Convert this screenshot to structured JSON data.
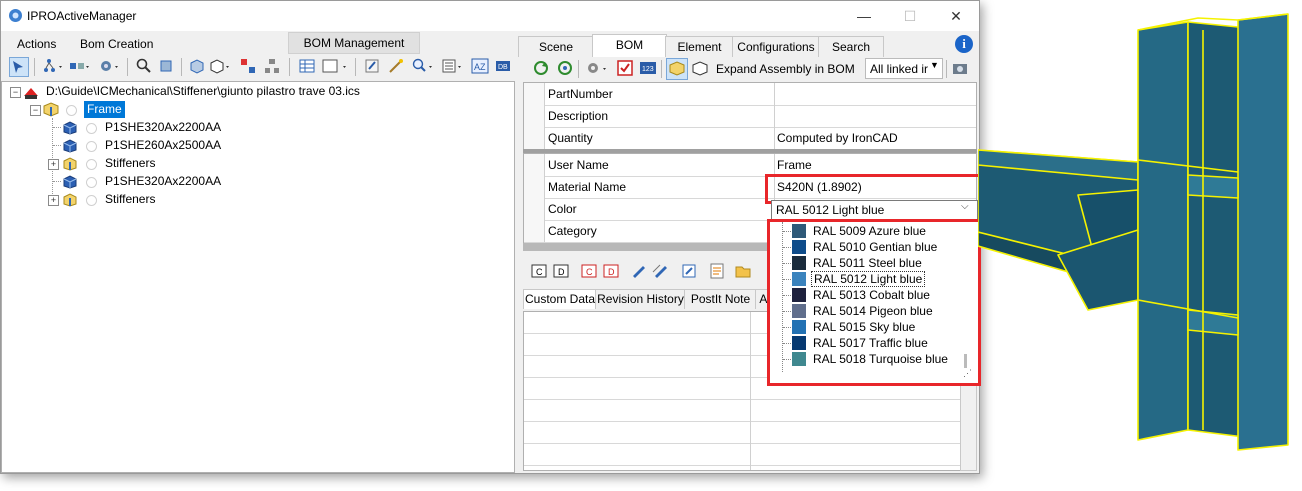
{
  "window": {
    "title": "IPROActiveManager",
    "controls": {
      "minimize": "—",
      "maximize": "☐",
      "close": "✕"
    }
  },
  "menu": {
    "actions": "Actions",
    "bom_creation": "Bom Creation",
    "bom_management": "BOM Management"
  },
  "tree": {
    "root_path": "D:\\Guide\\ICMechanical\\Stiffener\\giunto pilastro trave 03.ics",
    "frame_label": "Frame",
    "children": [
      {
        "label": "P1SHE320Ax2200AA",
        "type": "part",
        "expandable": false
      },
      {
        "label": "P1SHE260Ax2500AA",
        "type": "part",
        "expandable": false
      },
      {
        "label": "Stiffeners",
        "type": "assembly",
        "expandable": true
      },
      {
        "label": "P1SHE320Ax2200AA",
        "type": "part",
        "expandable": false
      },
      {
        "label": "Stiffeners",
        "type": "assembly",
        "expandable": true
      }
    ]
  },
  "right_tabs": [
    "Scene",
    "BOM",
    "Element",
    "Configurations",
    "Search"
  ],
  "right_active_tab": "BOM",
  "bom_toolbar": {
    "expand_label": "Expand Assembly in BOM",
    "linked_select": "All linked ir"
  },
  "props1": [
    {
      "key": "PartNumber",
      "value": ""
    },
    {
      "key": "Description",
      "value": ""
    },
    {
      "key": "Quantity",
      "value": "Computed by IronCAD"
    }
  ],
  "props2": [
    {
      "key": "User Name",
      "value": "Frame"
    },
    {
      "key": "Material Name",
      "value": "S420N  (1.8902)"
    },
    {
      "key": "Color",
      "value": "RAL 5012 Light blue"
    },
    {
      "key": "Category",
      "value": ""
    }
  ],
  "color_options": [
    {
      "label": "RAL 5009 Azure blue",
      "color": "#2e5978"
    },
    {
      "label": "RAL 5010 Gentian blue",
      "color": "#0e4c8a"
    },
    {
      "label": "RAL 5011 Steel blue",
      "color": "#1a2b3c"
    },
    {
      "label": "RAL 5012 Light blue",
      "color": "#3b83bd"
    },
    {
      "label": "RAL 5013 Cobalt blue",
      "color": "#1e213d"
    },
    {
      "label": "RAL 5014 Pigeon blue",
      "color": "#606e8c"
    },
    {
      "label": "RAL 5015 Sky blue",
      "color": "#2271b3"
    },
    {
      "label": "RAL 5017 Traffic blue",
      "color": "#063971"
    },
    {
      "label": "RAL 5018 Turquoise blue",
      "color": "#3f888f"
    }
  ],
  "color_selected_index": 3,
  "subtabs": [
    "Custom Data",
    "Revision History",
    "PostIt Note",
    "At"
  ],
  "subtab_active": "Custom Data",
  "colors": {
    "highlight_red": "#e8262a",
    "selection_blue": "#0078d7",
    "model_blue": "#1d5a73",
    "model_edges": "#f5f200"
  },
  "icons": [
    "app-logo-icon",
    "search-icon",
    "gear-icon",
    "checklist-icon",
    "info-icon",
    "refresh-icon",
    "assembly-icon",
    "part-icon",
    "camera-icon"
  ]
}
